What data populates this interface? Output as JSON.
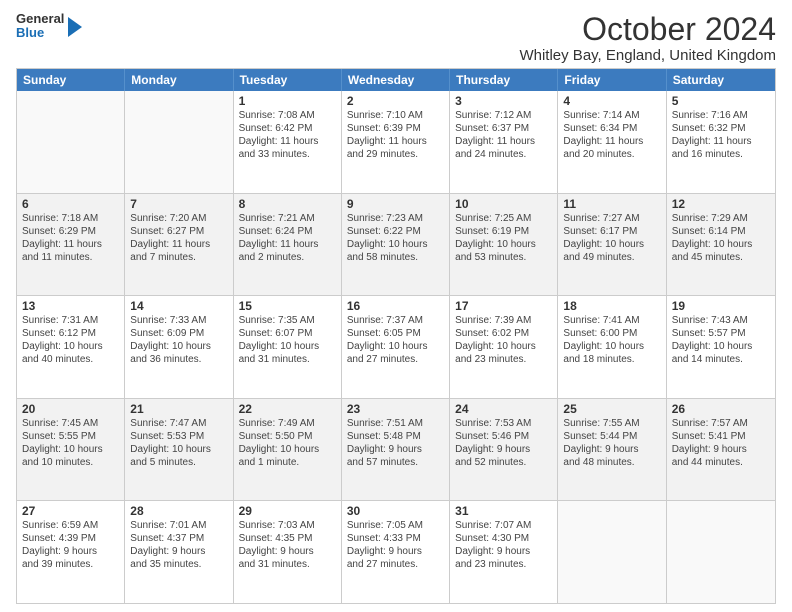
{
  "header": {
    "logo_general": "General",
    "logo_blue": "Blue",
    "title": "October 2024",
    "subtitle": "Whitley Bay, England, United Kingdom"
  },
  "days_of_week": [
    "Sunday",
    "Monday",
    "Tuesday",
    "Wednesday",
    "Thursday",
    "Friday",
    "Saturday"
  ],
  "rows": [
    [
      {
        "day": "",
        "lines": [],
        "empty": true
      },
      {
        "day": "",
        "lines": [],
        "empty": true
      },
      {
        "day": "1",
        "lines": [
          "Sunrise: 7:08 AM",
          "Sunset: 6:42 PM",
          "Daylight: 11 hours",
          "and 33 minutes."
        ]
      },
      {
        "day": "2",
        "lines": [
          "Sunrise: 7:10 AM",
          "Sunset: 6:39 PM",
          "Daylight: 11 hours",
          "and 29 minutes."
        ]
      },
      {
        "day": "3",
        "lines": [
          "Sunrise: 7:12 AM",
          "Sunset: 6:37 PM",
          "Daylight: 11 hours",
          "and 24 minutes."
        ]
      },
      {
        "day": "4",
        "lines": [
          "Sunrise: 7:14 AM",
          "Sunset: 6:34 PM",
          "Daylight: 11 hours",
          "and 20 minutes."
        ]
      },
      {
        "day": "5",
        "lines": [
          "Sunrise: 7:16 AM",
          "Sunset: 6:32 PM",
          "Daylight: 11 hours",
          "and 16 minutes."
        ]
      }
    ],
    [
      {
        "day": "6",
        "lines": [
          "Sunrise: 7:18 AM",
          "Sunset: 6:29 PM",
          "Daylight: 11 hours",
          "and 11 minutes."
        ],
        "shaded": true
      },
      {
        "day": "7",
        "lines": [
          "Sunrise: 7:20 AM",
          "Sunset: 6:27 PM",
          "Daylight: 11 hours",
          "and 7 minutes."
        ],
        "shaded": true
      },
      {
        "day": "8",
        "lines": [
          "Sunrise: 7:21 AM",
          "Sunset: 6:24 PM",
          "Daylight: 11 hours",
          "and 2 minutes."
        ],
        "shaded": true
      },
      {
        "day": "9",
        "lines": [
          "Sunrise: 7:23 AM",
          "Sunset: 6:22 PM",
          "Daylight: 10 hours",
          "and 58 minutes."
        ],
        "shaded": true
      },
      {
        "day": "10",
        "lines": [
          "Sunrise: 7:25 AM",
          "Sunset: 6:19 PM",
          "Daylight: 10 hours",
          "and 53 minutes."
        ],
        "shaded": true
      },
      {
        "day": "11",
        "lines": [
          "Sunrise: 7:27 AM",
          "Sunset: 6:17 PM",
          "Daylight: 10 hours",
          "and 49 minutes."
        ],
        "shaded": true
      },
      {
        "day": "12",
        "lines": [
          "Sunrise: 7:29 AM",
          "Sunset: 6:14 PM",
          "Daylight: 10 hours",
          "and 45 minutes."
        ],
        "shaded": true
      }
    ],
    [
      {
        "day": "13",
        "lines": [
          "Sunrise: 7:31 AM",
          "Sunset: 6:12 PM",
          "Daylight: 10 hours",
          "and 40 minutes."
        ]
      },
      {
        "day": "14",
        "lines": [
          "Sunrise: 7:33 AM",
          "Sunset: 6:09 PM",
          "Daylight: 10 hours",
          "and 36 minutes."
        ]
      },
      {
        "day": "15",
        "lines": [
          "Sunrise: 7:35 AM",
          "Sunset: 6:07 PM",
          "Daylight: 10 hours",
          "and 31 minutes."
        ]
      },
      {
        "day": "16",
        "lines": [
          "Sunrise: 7:37 AM",
          "Sunset: 6:05 PM",
          "Daylight: 10 hours",
          "and 27 minutes."
        ]
      },
      {
        "day": "17",
        "lines": [
          "Sunrise: 7:39 AM",
          "Sunset: 6:02 PM",
          "Daylight: 10 hours",
          "and 23 minutes."
        ]
      },
      {
        "day": "18",
        "lines": [
          "Sunrise: 7:41 AM",
          "Sunset: 6:00 PM",
          "Daylight: 10 hours",
          "and 18 minutes."
        ]
      },
      {
        "day": "19",
        "lines": [
          "Sunrise: 7:43 AM",
          "Sunset: 5:57 PM",
          "Daylight: 10 hours",
          "and 14 minutes."
        ]
      }
    ],
    [
      {
        "day": "20",
        "lines": [
          "Sunrise: 7:45 AM",
          "Sunset: 5:55 PM",
          "Daylight: 10 hours",
          "and 10 minutes."
        ],
        "shaded": true
      },
      {
        "day": "21",
        "lines": [
          "Sunrise: 7:47 AM",
          "Sunset: 5:53 PM",
          "Daylight: 10 hours",
          "and 5 minutes."
        ],
        "shaded": true
      },
      {
        "day": "22",
        "lines": [
          "Sunrise: 7:49 AM",
          "Sunset: 5:50 PM",
          "Daylight: 10 hours",
          "and 1 minute."
        ],
        "shaded": true
      },
      {
        "day": "23",
        "lines": [
          "Sunrise: 7:51 AM",
          "Sunset: 5:48 PM",
          "Daylight: 9 hours",
          "and 57 minutes."
        ],
        "shaded": true
      },
      {
        "day": "24",
        "lines": [
          "Sunrise: 7:53 AM",
          "Sunset: 5:46 PM",
          "Daylight: 9 hours",
          "and 52 minutes."
        ],
        "shaded": true
      },
      {
        "day": "25",
        "lines": [
          "Sunrise: 7:55 AM",
          "Sunset: 5:44 PM",
          "Daylight: 9 hours",
          "and 48 minutes."
        ],
        "shaded": true
      },
      {
        "day": "26",
        "lines": [
          "Sunrise: 7:57 AM",
          "Sunset: 5:41 PM",
          "Daylight: 9 hours",
          "and 44 minutes."
        ],
        "shaded": true
      }
    ],
    [
      {
        "day": "27",
        "lines": [
          "Sunrise: 6:59 AM",
          "Sunset: 4:39 PM",
          "Daylight: 9 hours",
          "and 39 minutes."
        ]
      },
      {
        "day": "28",
        "lines": [
          "Sunrise: 7:01 AM",
          "Sunset: 4:37 PM",
          "Daylight: 9 hours",
          "and 35 minutes."
        ]
      },
      {
        "day": "29",
        "lines": [
          "Sunrise: 7:03 AM",
          "Sunset: 4:35 PM",
          "Daylight: 9 hours",
          "and 31 minutes."
        ]
      },
      {
        "day": "30",
        "lines": [
          "Sunrise: 7:05 AM",
          "Sunset: 4:33 PM",
          "Daylight: 9 hours",
          "and 27 minutes."
        ]
      },
      {
        "day": "31",
        "lines": [
          "Sunrise: 7:07 AM",
          "Sunset: 4:30 PM",
          "Daylight: 9 hours",
          "and 23 minutes."
        ]
      },
      {
        "day": "",
        "lines": [],
        "empty": true
      },
      {
        "day": "",
        "lines": [],
        "empty": true
      }
    ]
  ]
}
